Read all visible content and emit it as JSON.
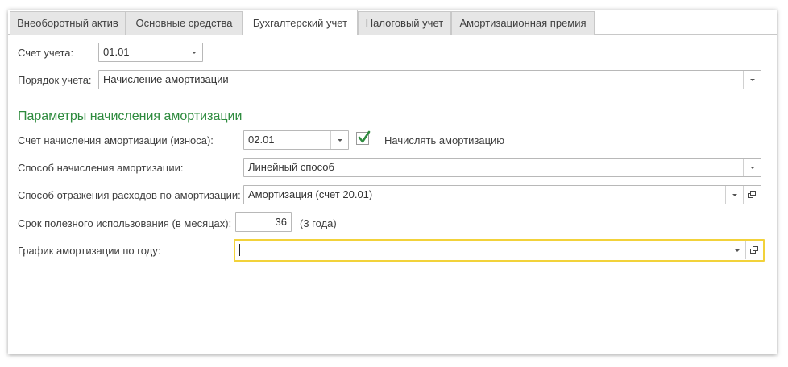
{
  "tabs": [
    {
      "label": "Внеоборотный актив",
      "active": false
    },
    {
      "label": "Основные средства",
      "active": false
    },
    {
      "label": "Бухгалтерский учет",
      "active": true
    },
    {
      "label": "Налоговый учет",
      "active": false
    },
    {
      "label": "Амортизационная премия",
      "active": false
    }
  ],
  "form": {
    "account_label": "Счет учета:",
    "account_value": "01.01",
    "order_label": "Порядок учета:",
    "order_value": "Начисление амортизации",
    "section_title": "Параметры начисления амортизации",
    "depr_account_label": "Счет начисления амортизации (износа):",
    "depr_account_value": "02.01",
    "accrue_checkbox_label": "Начислять амортизацию",
    "accrue_checked": true,
    "method_label": "Способ начисления амортизации:",
    "method_value": "Линейный способ",
    "expense_label": "Способ отражения расходов по амортизации:",
    "expense_value": "Амортизация (счет 20.01)",
    "term_label": "Срок полезного использования (в месяцах):",
    "term_value": "36",
    "term_hint": "(3 года)",
    "schedule_label": "График амортизации по году:",
    "schedule_value": ""
  },
  "colors": {
    "section_title": "#2e8b3e",
    "focus_border": "#f2d23a",
    "checkmark": "#2e8b3e"
  }
}
